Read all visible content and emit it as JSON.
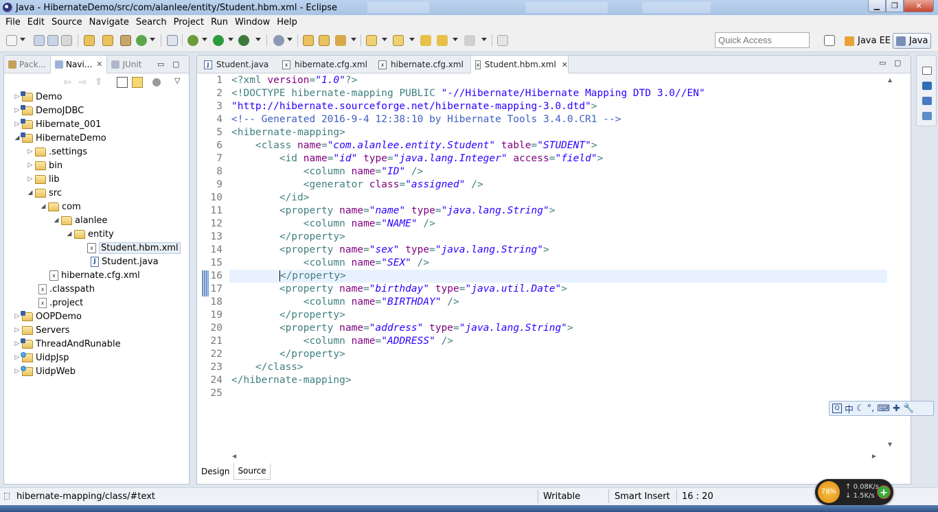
{
  "window": {
    "title": "Java - HibernateDemo/src/com/alanlee/entity/Student.hbm.xml - Eclipse",
    "minimize": "▁",
    "maximize": "❐",
    "close": "✕"
  },
  "menu": [
    "File",
    "Edit",
    "Source",
    "Navigate",
    "Search",
    "Project",
    "Run",
    "Window",
    "Help"
  ],
  "quick_access": {
    "placeholder": "Quick Access"
  },
  "perspectives": [
    {
      "label": "Java EE",
      "icon": "java-ee-perspective-icon"
    },
    {
      "label": "Java",
      "icon": "java-perspective-icon"
    }
  ],
  "left_view": {
    "tabs": [
      {
        "label": "Pack...",
        "icon": "package-explorer-icon"
      },
      {
        "label": "Navi...",
        "icon": "navigator-icon"
      },
      {
        "label": "JUnit",
        "icon": "junit-icon"
      }
    ],
    "close": "✕",
    "minimize": "▭",
    "maximize": "▢",
    "tree": [
      {
        "label": "Demo",
        "type": "project",
        "expanded": false
      },
      {
        "label": "DemoJDBC",
        "type": "project",
        "expanded": false
      },
      {
        "label": "Hibernate_001",
        "type": "project",
        "expanded": false
      },
      {
        "label": "HibernateDemo",
        "type": "project",
        "expanded": true
      },
      {
        "label": ".settings",
        "type": "folder",
        "expanded": false
      },
      {
        "label": "bin",
        "type": "folder",
        "expanded": false
      },
      {
        "label": "lib",
        "type": "folder",
        "expanded": false
      },
      {
        "label": "src",
        "type": "folder",
        "expanded": true
      },
      {
        "label": "com",
        "type": "folder",
        "expanded": true
      },
      {
        "label": "alanlee",
        "type": "folder",
        "expanded": true
      },
      {
        "label": "entity",
        "type": "folder",
        "expanded": true
      },
      {
        "label": "Student.hbm.xml",
        "type": "xml",
        "selected": true
      },
      {
        "label": "Student.java",
        "type": "java"
      },
      {
        "label": "hibernate.cfg.xml",
        "type": "xml"
      },
      {
        "label": ".classpath",
        "type": "text"
      },
      {
        "label": ".project",
        "type": "text"
      },
      {
        "label": "OOPDemo",
        "type": "project",
        "expanded": false
      },
      {
        "label": "Servers",
        "type": "folder",
        "expanded": false
      },
      {
        "label": "ThreadAndRunable",
        "type": "project",
        "expanded": false
      },
      {
        "label": "UidpJsp",
        "type": "webproject",
        "expanded": false
      },
      {
        "label": "UidpWeb",
        "type": "webproject",
        "expanded": false
      }
    ]
  },
  "editor": {
    "tabs": [
      {
        "label": "Student.java",
        "icon": "java-file-icon"
      },
      {
        "label": "hibernate.cfg.xml",
        "icon": "xml-file-icon"
      },
      {
        "label": "hibernate.cfg.xml",
        "icon": "xml-file-icon"
      },
      {
        "label": "Student.hbm.xml",
        "icon": "xml-file-icon",
        "active": true
      }
    ],
    "close": "✕",
    "current_line": 16,
    "lines": [
      [
        [
          "p",
          "<?xml "
        ],
        [
          "a",
          "version"
        ],
        [
          "p",
          "="
        ],
        [
          "v",
          "\"1.0\""
        ],
        [
          "p",
          "?>"
        ]
      ],
      [
        [
          "p",
          "<!DOCTYPE "
        ],
        [
          "t",
          "hibernate-mapping"
        ],
        [
          "p",
          " PUBLIC "
        ],
        [
          "s",
          "\"-//Hibernate/Hibernate Mapping DTD 3.0//EN\""
        ]
      ],
      [
        [
          "s",
          "\"http://hibernate.sourceforge.net/hibernate-mapping-3.0.dtd\""
        ],
        [
          "p",
          ">"
        ]
      ],
      [
        [
          "c",
          "<!-- Generated 2016-9-4 12:38:10 by Hibernate Tools 3.4.0.CR1 -->"
        ]
      ],
      [
        [
          "p",
          "<hibernate-mapping>"
        ]
      ],
      [
        [
          "p",
          "    <class "
        ],
        [
          "a",
          "name"
        ],
        [
          "p",
          "="
        ],
        [
          "v",
          "\"com.alanlee.entity.Student\""
        ],
        [
          "p",
          " "
        ],
        [
          "a",
          "table"
        ],
        [
          "p",
          "="
        ],
        [
          "v",
          "\"STUDENT\""
        ],
        [
          "p",
          ">"
        ]
      ],
      [
        [
          "p",
          "        <id "
        ],
        [
          "a",
          "name"
        ],
        [
          "p",
          "="
        ],
        [
          "v",
          "\"id\""
        ],
        [
          "p",
          " "
        ],
        [
          "a",
          "type"
        ],
        [
          "p",
          "="
        ],
        [
          "v",
          "\"java.lang.Integer\""
        ],
        [
          "p",
          " "
        ],
        [
          "a",
          "access"
        ],
        [
          "p",
          "="
        ],
        [
          "v",
          "\"field\""
        ],
        [
          "p",
          ">"
        ]
      ],
      [
        [
          "p",
          "            <column "
        ],
        [
          "a",
          "name"
        ],
        [
          "p",
          "="
        ],
        [
          "v",
          "\"ID\""
        ],
        [
          "p",
          " />"
        ]
      ],
      [
        [
          "p",
          "            <generator "
        ],
        [
          "a",
          "class"
        ],
        [
          "p",
          "="
        ],
        [
          "v",
          "\"assigned\""
        ],
        [
          "p",
          " />"
        ]
      ],
      [
        [
          "p",
          "        </id>"
        ]
      ],
      [
        [
          "p",
          "        <property "
        ],
        [
          "a",
          "name"
        ],
        [
          "p",
          "="
        ],
        [
          "v",
          "\"name\""
        ],
        [
          "p",
          " "
        ],
        [
          "a",
          "type"
        ],
        [
          "p",
          "="
        ],
        [
          "v",
          "\"java.lang.String\""
        ],
        [
          "p",
          ">"
        ]
      ],
      [
        [
          "p",
          "            <column "
        ],
        [
          "a",
          "name"
        ],
        [
          "p",
          "="
        ],
        [
          "v",
          "\"NAME\""
        ],
        [
          "p",
          " />"
        ]
      ],
      [
        [
          "p",
          "        </property>"
        ]
      ],
      [
        [
          "p",
          "        <property "
        ],
        [
          "a",
          "name"
        ],
        [
          "p",
          "="
        ],
        [
          "v",
          "\"sex\""
        ],
        [
          "p",
          " "
        ],
        [
          "a",
          "type"
        ],
        [
          "p",
          "="
        ],
        [
          "v",
          "\"java.lang.String\""
        ],
        [
          "p",
          ">"
        ]
      ],
      [
        [
          "p",
          "            <column "
        ],
        [
          "a",
          "name"
        ],
        [
          "p",
          "="
        ],
        [
          "v",
          "\"SEX\""
        ],
        [
          "p",
          " />"
        ]
      ],
      [
        [
          "p",
          "        "
        ],
        [
          "k",
          ""
        ],
        [
          "p",
          "</property>"
        ]
      ],
      [
        [
          "p",
          "        <property "
        ],
        [
          "a",
          "name"
        ],
        [
          "p",
          "="
        ],
        [
          "v",
          "\"birthday\""
        ],
        [
          "p",
          " "
        ],
        [
          "a",
          "type"
        ],
        [
          "p",
          "="
        ],
        [
          "v",
          "\"java.util.Date\""
        ],
        [
          "p",
          ">"
        ]
      ],
      [
        [
          "p",
          "            <column "
        ],
        [
          "a",
          "name"
        ],
        [
          "p",
          "="
        ],
        [
          "v",
          "\"BIRTHDAY\""
        ],
        [
          "p",
          " />"
        ]
      ],
      [
        [
          "p",
          "        </property>"
        ]
      ],
      [
        [
          "p",
          "        <property "
        ],
        [
          "a",
          "name"
        ],
        [
          "p",
          "="
        ],
        [
          "v",
          "\"address\""
        ],
        [
          "p",
          " "
        ],
        [
          "a",
          "type"
        ],
        [
          "p",
          "="
        ],
        [
          "v",
          "\"java.lang.String\""
        ],
        [
          "p",
          ">"
        ]
      ],
      [
        [
          "p",
          "            <column "
        ],
        [
          "a",
          "name"
        ],
        [
          "p",
          "="
        ],
        [
          "v",
          "\"ADDRESS\""
        ],
        [
          "p",
          " />"
        ]
      ],
      [
        [
          "p",
          "        </property>"
        ]
      ],
      [
        [
          "p",
          "    </class>"
        ]
      ],
      [
        [
          "p",
          "</hibernate-mapping>"
        ]
      ],
      []
    ],
    "bottom_tabs": [
      {
        "label": "Design"
      },
      {
        "label": "Source",
        "active": true
      }
    ]
  },
  "colors": {
    "tag": "#3f7f7f",
    "attr": "#7f007f",
    "value": "#2a00ff",
    "comment": "#3f5fbf",
    "line_number": "#787878",
    "current_line": "#e8f2fe"
  },
  "ime": [
    "中",
    "☾",
    "°,",
    "⌨",
    "✚",
    "🔧"
  ],
  "status": {
    "path": "hibernate-mapping/class/#text",
    "writable": "Writable",
    "insert_mode": "Smart Insert",
    "position": "16 : 20"
  },
  "net_widget": {
    "percent": "78%",
    "up": "0.08K/s",
    "down": "1.5K/s"
  }
}
